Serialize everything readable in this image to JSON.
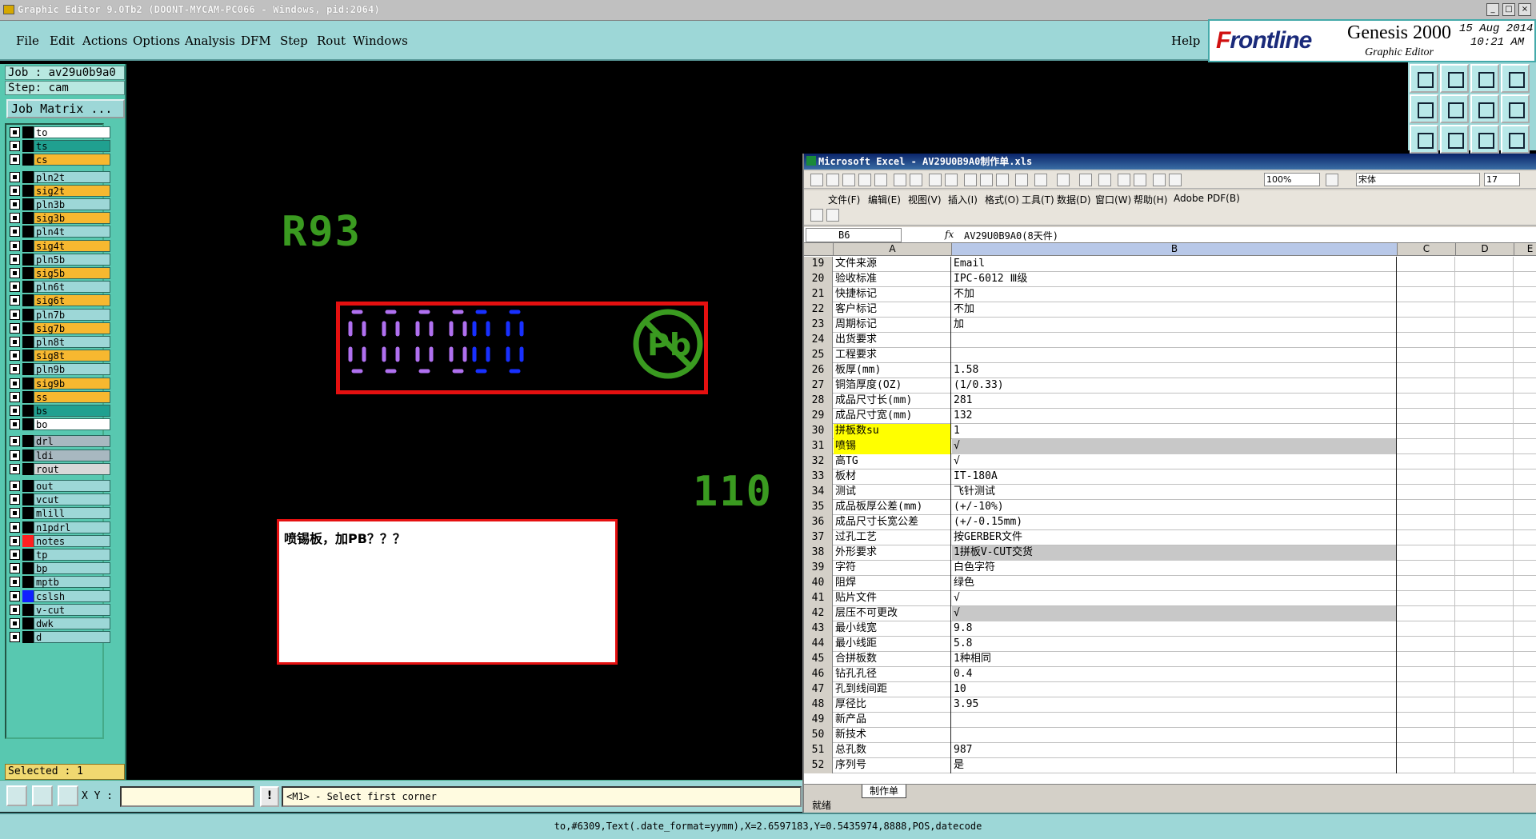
{
  "window_title": "Graphic Editor 9.0Tb2 (DOONT-MYCAM-PC066 - Windows, pid:2064)",
  "menus": [
    "File",
    "Edit",
    "Actions",
    "Options",
    "Analysis",
    "DFM",
    "Step",
    "Rout",
    "Windows"
  ],
  "help": "Help",
  "brand": {
    "logo_a": "F",
    "logo_b": "rontline",
    "product": "Genesis 2000",
    "subtitle": "Graphic Editor",
    "date": "15 Aug 2014",
    "time": "10:21 AM"
  },
  "job": {
    "job": "Job : av29u0b9a0",
    "step": "Step: cam",
    "matrix_btn": "Job Matrix ..."
  },
  "layers": [
    {
      "name": "to",
      "color": "#ffffff",
      "sw": "#000000"
    },
    {
      "name": "ts",
      "color": "#20a090",
      "sw": "#000000"
    },
    {
      "name": "cs",
      "color": "#f7b830",
      "sw": "#000000"
    },
    {
      "name": "pln2t",
      "color": "#9dd7d7",
      "sw": "#000000"
    },
    {
      "name": "sig2t",
      "color": "#f7b830",
      "sw": "#000000"
    },
    {
      "name": "pln3b",
      "color": "#9dd7d7",
      "sw": "#000000"
    },
    {
      "name": "sig3b",
      "color": "#f7b830",
      "sw": "#000000"
    },
    {
      "name": "pln4t",
      "color": "#9dd7d7",
      "sw": "#000000"
    },
    {
      "name": "sig4t",
      "color": "#f7b830",
      "sw": "#000000"
    },
    {
      "name": "pln5b",
      "color": "#9dd7d7",
      "sw": "#000000"
    },
    {
      "name": "sig5b",
      "color": "#f7b830",
      "sw": "#000000"
    },
    {
      "name": "pln6t",
      "color": "#9dd7d7",
      "sw": "#000000"
    },
    {
      "name": "sig6t",
      "color": "#f7b830",
      "sw": "#000000"
    },
    {
      "name": "pln7b",
      "color": "#9dd7d7",
      "sw": "#000000"
    },
    {
      "name": "sig7b",
      "color": "#f7b830",
      "sw": "#000000"
    },
    {
      "name": "pln8t",
      "color": "#9dd7d7",
      "sw": "#000000"
    },
    {
      "name": "sig8t",
      "color": "#f7b830",
      "sw": "#000000"
    },
    {
      "name": "pln9b",
      "color": "#9dd7d7",
      "sw": "#000000"
    },
    {
      "name": "sig9b",
      "color": "#f7b830",
      "sw": "#000000"
    },
    {
      "name": "ss",
      "color": "#f7b830",
      "sw": "#000000"
    },
    {
      "name": "bs",
      "color": "#20a090",
      "sw": "#000000"
    },
    {
      "name": "bo",
      "color": "#ffffff",
      "sw": "#000000"
    },
    {
      "name": "drl",
      "color": "#a8b8c0",
      "sw": "#000000"
    },
    {
      "name": "ldi",
      "color": "#a8b8c0",
      "sw": "#000000"
    },
    {
      "name": "rout",
      "color": "#d8d8d8",
      "sw": "#000000"
    },
    {
      "name": "out",
      "color": "#9dd7d7",
      "sw": "#000000"
    },
    {
      "name": "vcut",
      "color": "#9dd7d7",
      "sw": "#000000"
    },
    {
      "name": "mlill",
      "color": "#9dd7d7",
      "sw": "#000000"
    },
    {
      "name": "n1pdrl",
      "color": "#9dd7d7",
      "sw": "#000000"
    },
    {
      "name": "notes",
      "color": "#9dd7d7",
      "sw": "#ff2020"
    },
    {
      "name": "tp",
      "color": "#9dd7d7",
      "sw": "#000000"
    },
    {
      "name": "bp",
      "color": "#9dd7d7",
      "sw": "#000000"
    },
    {
      "name": "mptb",
      "color": "#9dd7d7",
      "sw": "#000000"
    },
    {
      "name": "cslsh",
      "color": "#9dd7d7",
      "sw": "#1020ff"
    },
    {
      "name": "v-cut",
      "color": "#9dd7d7",
      "sw": "#000000"
    },
    {
      "name": "dwk",
      "color": "#9dd7d7",
      "sw": "#000000"
    },
    {
      "name": "d",
      "color": "#9dd7d7",
      "sw": "#000000"
    }
  ],
  "selected": "Selected : 1",
  "canvas": {
    "r93": "R93",
    "n110": "110",
    "note": "喷锡板，加PB？？？"
  },
  "bottom": {
    "xy_label": "X Y :",
    "xy_value": "",
    "exclaim": "!",
    "prompt": "<M1> - Select first corner"
  },
  "status": "to,#6309,Text(.date_format=yymm),X=2.6597183,Y=0.5435974,8888,POS,datecode",
  "excel": {
    "title": "Microsoft Excel - AV29U0B9A0制作单.xls",
    "zoom": "100%",
    "font": "宋体",
    "size": "17",
    "menus": [
      "文件(F)",
      "编辑(E)",
      "视图(V)",
      "插入(I)",
      "格式(O)",
      "工具(T)",
      "数据(D)",
      "窗口(W)",
      "帮助(H)",
      "Adobe PDF(B)"
    ],
    "cellref": "B6",
    "formula": "AV29U0B9A0(8天件)",
    "cols": [
      "A",
      "B",
      "C",
      "D",
      "E"
    ],
    "rows": [
      {
        "n": "19",
        "a": "文件来源",
        "b": "Email"
      },
      {
        "n": "20",
        "a": "验收标准",
        "b": "IPC-6012 Ⅲ级"
      },
      {
        "n": "21",
        "a": "快捷标记",
        "b": "不加"
      },
      {
        "n": "22",
        "a": "客户标记",
        "b": "不加"
      },
      {
        "n": "23",
        "a": "周期标记",
        "b": "加"
      },
      {
        "n": "24",
        "a": "出货要求",
        "b": ""
      },
      {
        "n": "25",
        "a": "工程要求",
        "b": ""
      },
      {
        "n": "26",
        "a": "板厚(mm)",
        "b": "1.58"
      },
      {
        "n": "27",
        "a": "铜箔厚度(OZ)",
        "b": "(1/0.33)"
      },
      {
        "n": "28",
        "a": "成品尺寸长(mm)",
        "b": "281"
      },
      {
        "n": "29",
        "a": "成品尺寸宽(mm)",
        "b": "132"
      },
      {
        "n": "30",
        "a": "拼板数su",
        "b": "1"
      },
      {
        "n": "31",
        "a": "喷锡",
        "b": "√"
      },
      {
        "n": "32",
        "a": "高TG",
        "b": "√"
      },
      {
        "n": "33",
        "a": "板材",
        "b": "IT-180A"
      },
      {
        "n": "34",
        "a": "测试",
        "b": "飞针测试"
      },
      {
        "n": "35",
        "a": "成品板厚公差(mm)",
        "b": "(+/-10%)"
      },
      {
        "n": "36",
        "a": "成品尺寸长宽公差",
        "b": "(+/-0.15mm)"
      },
      {
        "n": "37",
        "a": "过孔工艺",
        "b": "按GERBER文件"
      },
      {
        "n": "38",
        "a": "外形要求",
        "b": "1拼板V-CUT交货"
      },
      {
        "n": "39",
        "a": "字符",
        "b": "白色字符"
      },
      {
        "n": "40",
        "a": "阻焊",
        "b": "绿色"
      },
      {
        "n": "41",
        "a": "贴片文件",
        "b": "√"
      },
      {
        "n": "42",
        "a": "层压不可更改",
        "b": "√"
      },
      {
        "n": "43",
        "a": "最小线宽",
        "b": "9.8"
      },
      {
        "n": "44",
        "a": "最小线距",
        "b": "5.8"
      },
      {
        "n": "45",
        "a": "合拼板数",
        "b": "1种相同"
      },
      {
        "n": "46",
        "a": "钻孔孔径",
        "b": "0.4"
      },
      {
        "n": "47",
        "a": "孔到线间距",
        "b": "10"
      },
      {
        "n": "48",
        "a": "厚径比",
        "b": "3.95"
      },
      {
        "n": "49",
        "a": "新产品",
        "b": ""
      },
      {
        "n": "50",
        "a": "新技术",
        "b": ""
      },
      {
        "n": "51",
        "a": "总孔数",
        "b": "987"
      },
      {
        "n": "52",
        "a": "序列号",
        "b": "是"
      }
    ],
    "sheet": "制作单",
    "status": "就绪"
  }
}
